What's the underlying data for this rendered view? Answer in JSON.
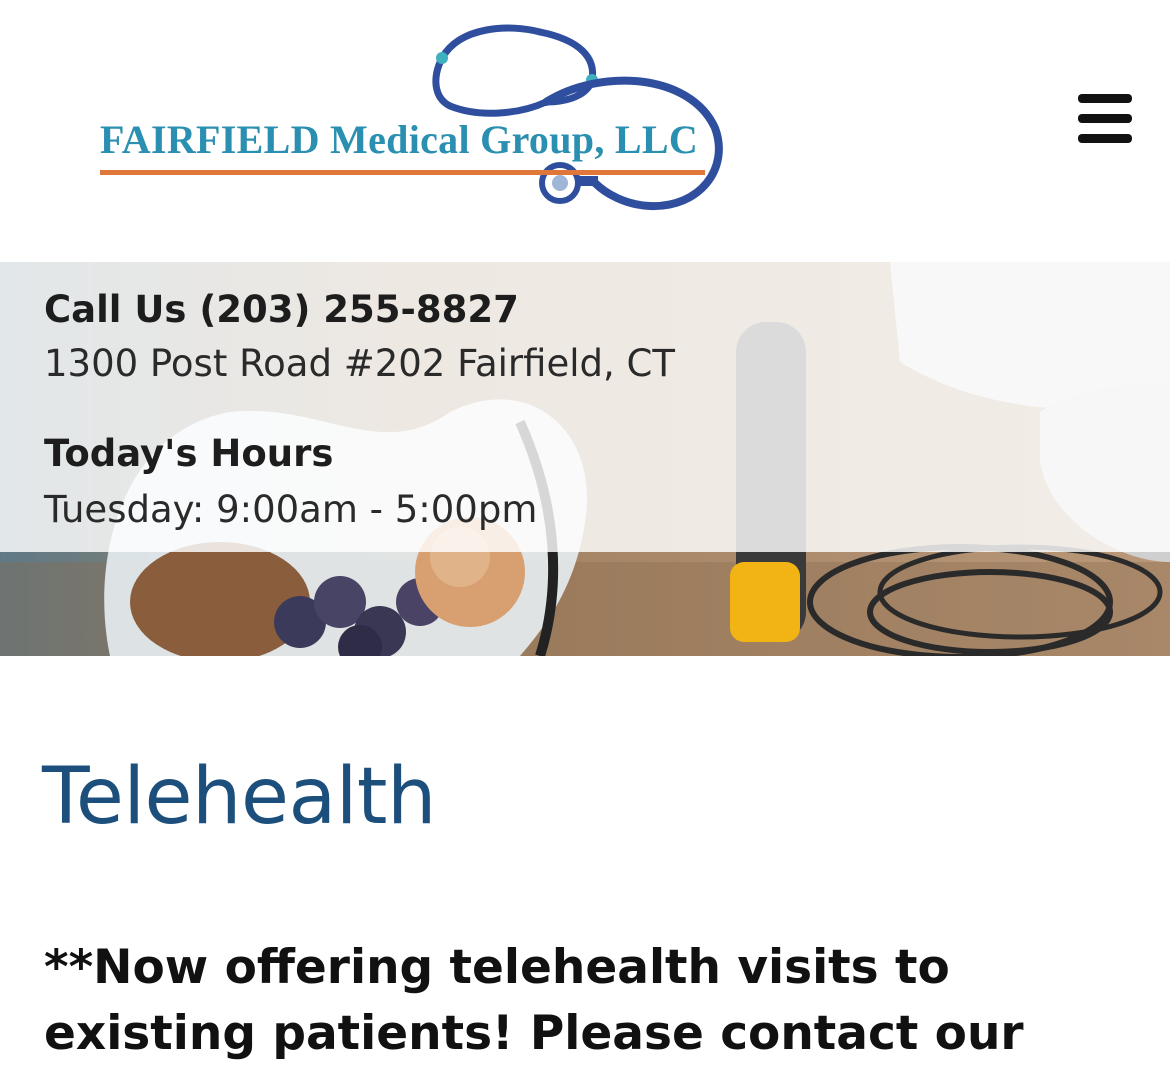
{
  "header": {
    "logo_text": "FAIRFIELD Medical Group, LLC",
    "logo_icon": "stethoscope-icon",
    "menu_icon": "hamburger-menu-icon"
  },
  "banner": {
    "call_us": "Call Us (203) 255-8827",
    "address": "1300 Post Road #202 Fairfield, CT",
    "hours_label": "Today's Hours",
    "hours_value": "Tuesday: 9:00am - 5:00pm"
  },
  "main": {
    "title": "Telehealth",
    "announcement": "**Now offering telehealth visits to existing patients! Please contact our"
  },
  "colors": {
    "logo_blue": "#2a8fb0",
    "logo_orange": "#e0773a",
    "stethoscope_blue": "#2f4f9e",
    "title_blue": "#1d4f7c",
    "text_dark": "#1d1d1d"
  }
}
